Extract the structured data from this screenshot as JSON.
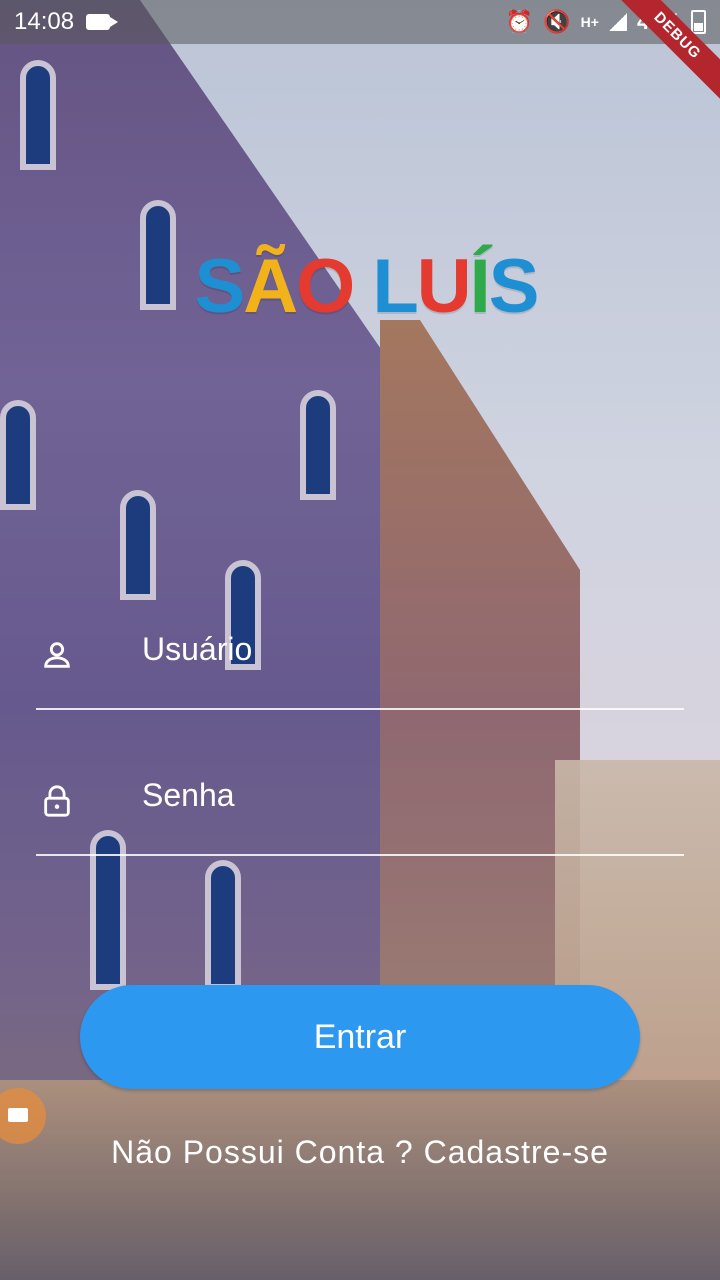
{
  "status_bar": {
    "time": "14:08",
    "battery": "40%",
    "network": "H+",
    "debug_banner": "DEBUG"
  },
  "logo": {
    "letters": [
      {
        "char": "S",
        "color": "#1f8fd3"
      },
      {
        "char": "Ã",
        "color": "#f2b21a"
      },
      {
        "char": "O",
        "color": "#e53a2f"
      },
      {
        "char": " ",
        "color": "#ffffff"
      },
      {
        "char": "L",
        "color": "#1f8fd3"
      },
      {
        "char": "U",
        "color": "#e53a2f"
      },
      {
        "char": "Í",
        "color": "#2eaa4a"
      },
      {
        "char": "S",
        "color": "#1f8fd3"
      }
    ]
  },
  "form": {
    "username": {
      "value": "Usuário",
      "icon": "person-icon"
    },
    "password": {
      "value": "Senha",
      "icon": "lock-icon"
    }
  },
  "actions": {
    "login_label": "Entrar",
    "signup_label": "Não Possui Conta ? Cadastre-se"
  },
  "colors": {
    "primary": "#2d98ef",
    "text": "#ffffff"
  }
}
